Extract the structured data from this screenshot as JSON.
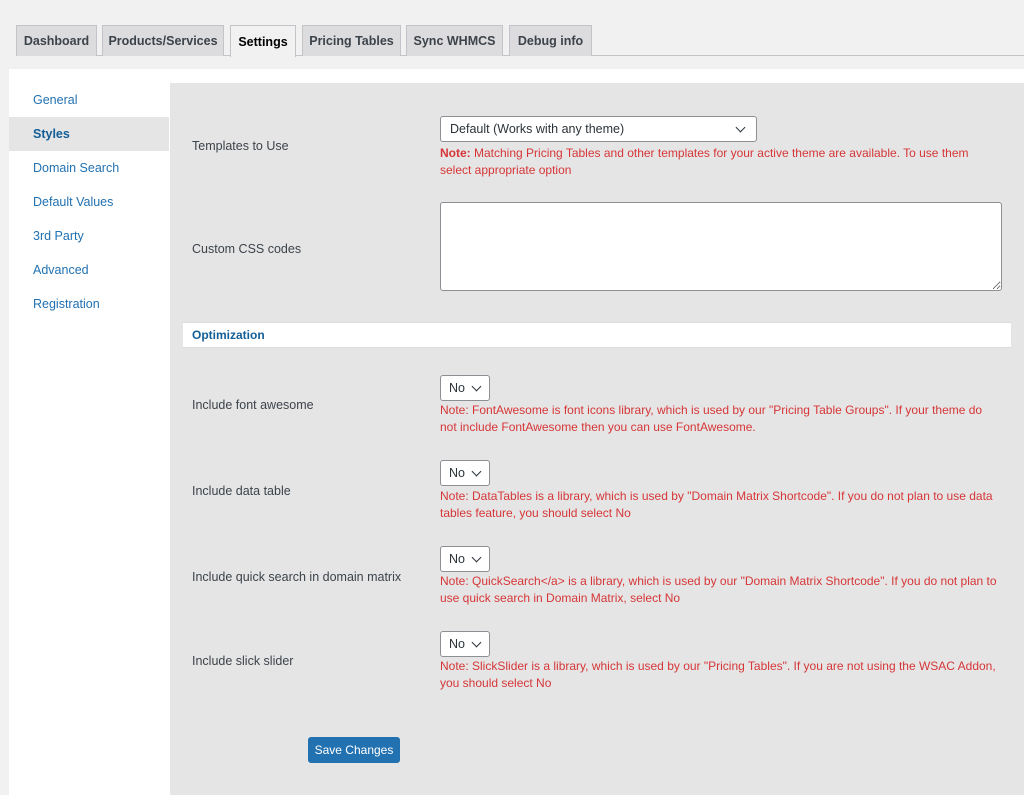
{
  "tabs": [
    {
      "label": "Dashboard",
      "active": false
    },
    {
      "label": "Products/Services",
      "active": false
    },
    {
      "label": "Settings",
      "active": true
    },
    {
      "label": "Pricing Tables",
      "active": false
    },
    {
      "label": "Sync WHMCS",
      "active": false
    },
    {
      "label": "Debug info",
      "active": false
    }
  ],
  "sidebar": {
    "items": [
      {
        "label": "General",
        "active": false
      },
      {
        "label": "Styles",
        "active": true
      },
      {
        "label": "Domain Search",
        "active": false
      },
      {
        "label": "Default Values",
        "active": false
      },
      {
        "label": "3rd Party",
        "active": false
      },
      {
        "label": "Advanced",
        "active": false
      },
      {
        "label": "Registration",
        "active": false
      }
    ]
  },
  "styles": {
    "templates": {
      "label": "Templates to Use",
      "selected": "Default (Works with any theme)",
      "note_prefix": "Note:",
      "note": " Matching Pricing Tables and other templates for your active theme are available. To use them select appropriate option"
    },
    "custom_css": {
      "label": "Custom CSS codes",
      "value": ""
    }
  },
  "optimization": {
    "header": "Optimization",
    "rows": [
      {
        "label": "Include font awesome",
        "selected": "No",
        "note": "Note: FontAwesome is font icons library, which is used by our \"Pricing Table Groups\". If your theme do not include FontAwesome then you can use FontAwesome."
      },
      {
        "label": "Include data table",
        "selected": "No",
        "note": "Note: DataTables is a library, which is used by \"Domain Matrix Shortcode\". If you do not plan to use data tables feature, you should select No"
      },
      {
        "label": "Include quick search in domain matrix",
        "selected": "No",
        "note": "Note: QuickSearch</a> is a library, which is used by our \"Domain Matrix Shortcode\". If you do not plan to use quick search in Domain Matrix, select No"
      },
      {
        "label": "Include slick slider",
        "selected": "No",
        "note": "Note: SlickSlider is a library, which is used by our \"Pricing Tables\". If you are not using the WSAC Addon, you should select No"
      }
    ]
  },
  "actions": {
    "save_label": "Save Changes"
  },
  "colors": {
    "accent": "#2271b1",
    "note_red": "#d63638",
    "content_bg": "#e5e5e5"
  }
}
